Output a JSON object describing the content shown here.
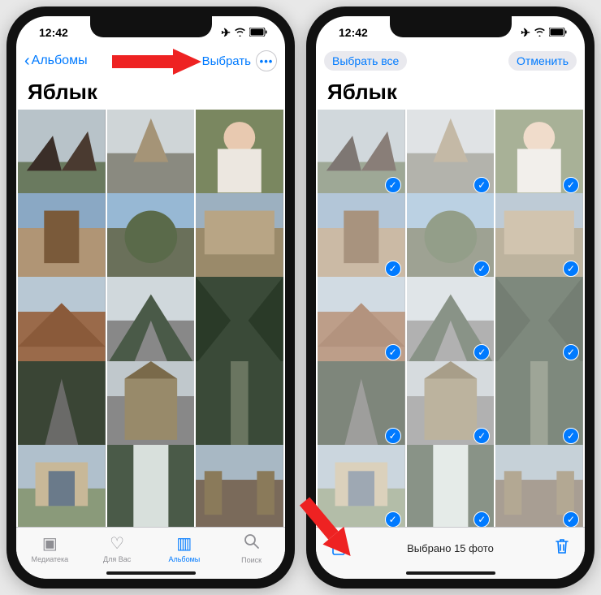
{
  "statusbar": {
    "time": "12:42"
  },
  "left": {
    "nav": {
      "back": "Альбомы",
      "select": "Выбрать"
    },
    "title": "Яблык",
    "tabs": [
      {
        "label": "Медиатека"
      },
      {
        "label": "Для Вас"
      },
      {
        "label": "Альбомы"
      },
      {
        "label": "Поиск"
      }
    ]
  },
  "right": {
    "nav": {
      "selectAll": "Выбрать все",
      "cancel": "Отменить"
    },
    "title": "Яблык",
    "status": "Выбрано 15 фото"
  }
}
